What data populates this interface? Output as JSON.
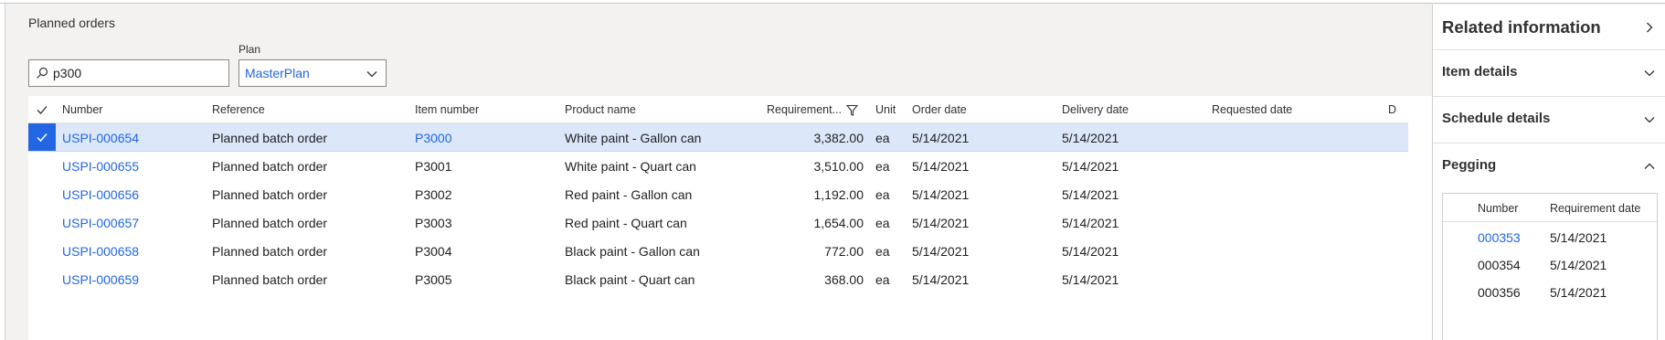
{
  "section_title": "Planned orders",
  "search": {
    "value": "p300",
    "placeholder": ""
  },
  "plan": {
    "label": "Plan",
    "value": "MasterPlan"
  },
  "grid": {
    "columns": [
      "Number",
      "Reference",
      "Item number",
      "Product name",
      "Requirement...",
      "Unit",
      "Order date",
      "Delivery date",
      "Requested date",
      "D"
    ],
    "rows": [
      {
        "number": "USPI-000654",
        "reference": "Planned batch order",
        "item": "P3000",
        "product": "White paint - Gallon can",
        "requirement": "3,382.00",
        "unit": "ea",
        "order_date": "5/14/2021",
        "delivery_date": "5/14/2021",
        "requested_date": "",
        "selected": true
      },
      {
        "number": "USPI-000655",
        "reference": "Planned batch order",
        "item": "P3001",
        "product": "White paint - Quart can",
        "requirement": "3,510.00",
        "unit": "ea",
        "order_date": "5/14/2021",
        "delivery_date": "5/14/2021",
        "requested_date": ""
      },
      {
        "number": "USPI-000656",
        "reference": "Planned batch order",
        "item": "P3002",
        "product": "Red paint - Gallon can",
        "requirement": "1,192.00",
        "unit": "ea",
        "order_date": "5/14/2021",
        "delivery_date": "5/14/2021",
        "requested_date": ""
      },
      {
        "number": "USPI-000657",
        "reference": "Planned batch order",
        "item": "P3003",
        "product": "Red paint - Quart can",
        "requirement": "1,654.00",
        "unit": "ea",
        "order_date": "5/14/2021",
        "delivery_date": "5/14/2021",
        "requested_date": ""
      },
      {
        "number": "USPI-000658",
        "reference": "Planned batch order",
        "item": "P3004",
        "product": "Black paint - Gallon can",
        "requirement": "772.00",
        "unit": "ea",
        "order_date": "5/14/2021",
        "delivery_date": "5/14/2021",
        "requested_date": ""
      },
      {
        "number": "USPI-000659",
        "reference": "Planned batch order",
        "item": "P3005",
        "product": "Black paint - Quart can",
        "requirement": "368.00",
        "unit": "ea",
        "order_date": "5/14/2021",
        "delivery_date": "5/14/2021",
        "requested_date": ""
      }
    ]
  },
  "side": {
    "title": "Related information",
    "item_details": "Item details",
    "schedule_details": "Schedule details",
    "pegging": "Pegging",
    "peg_columns": [
      "Number",
      "Requirement date"
    ],
    "peg_rows": [
      {
        "number": "000353",
        "date": "5/14/2021"
      },
      {
        "number": "000354",
        "date": "5/14/2021"
      },
      {
        "number": "000356",
        "date": "5/14/2021"
      }
    ]
  },
  "colors": {
    "accent": "#2266e3",
    "selected_row": "#dce7fa",
    "background": "#f3f2f1"
  },
  "icons": [
    "search-icon",
    "chevron-down-icon",
    "check-icon",
    "filter-icon",
    "chevron-right-icon",
    "chevron-up-icon"
  ]
}
